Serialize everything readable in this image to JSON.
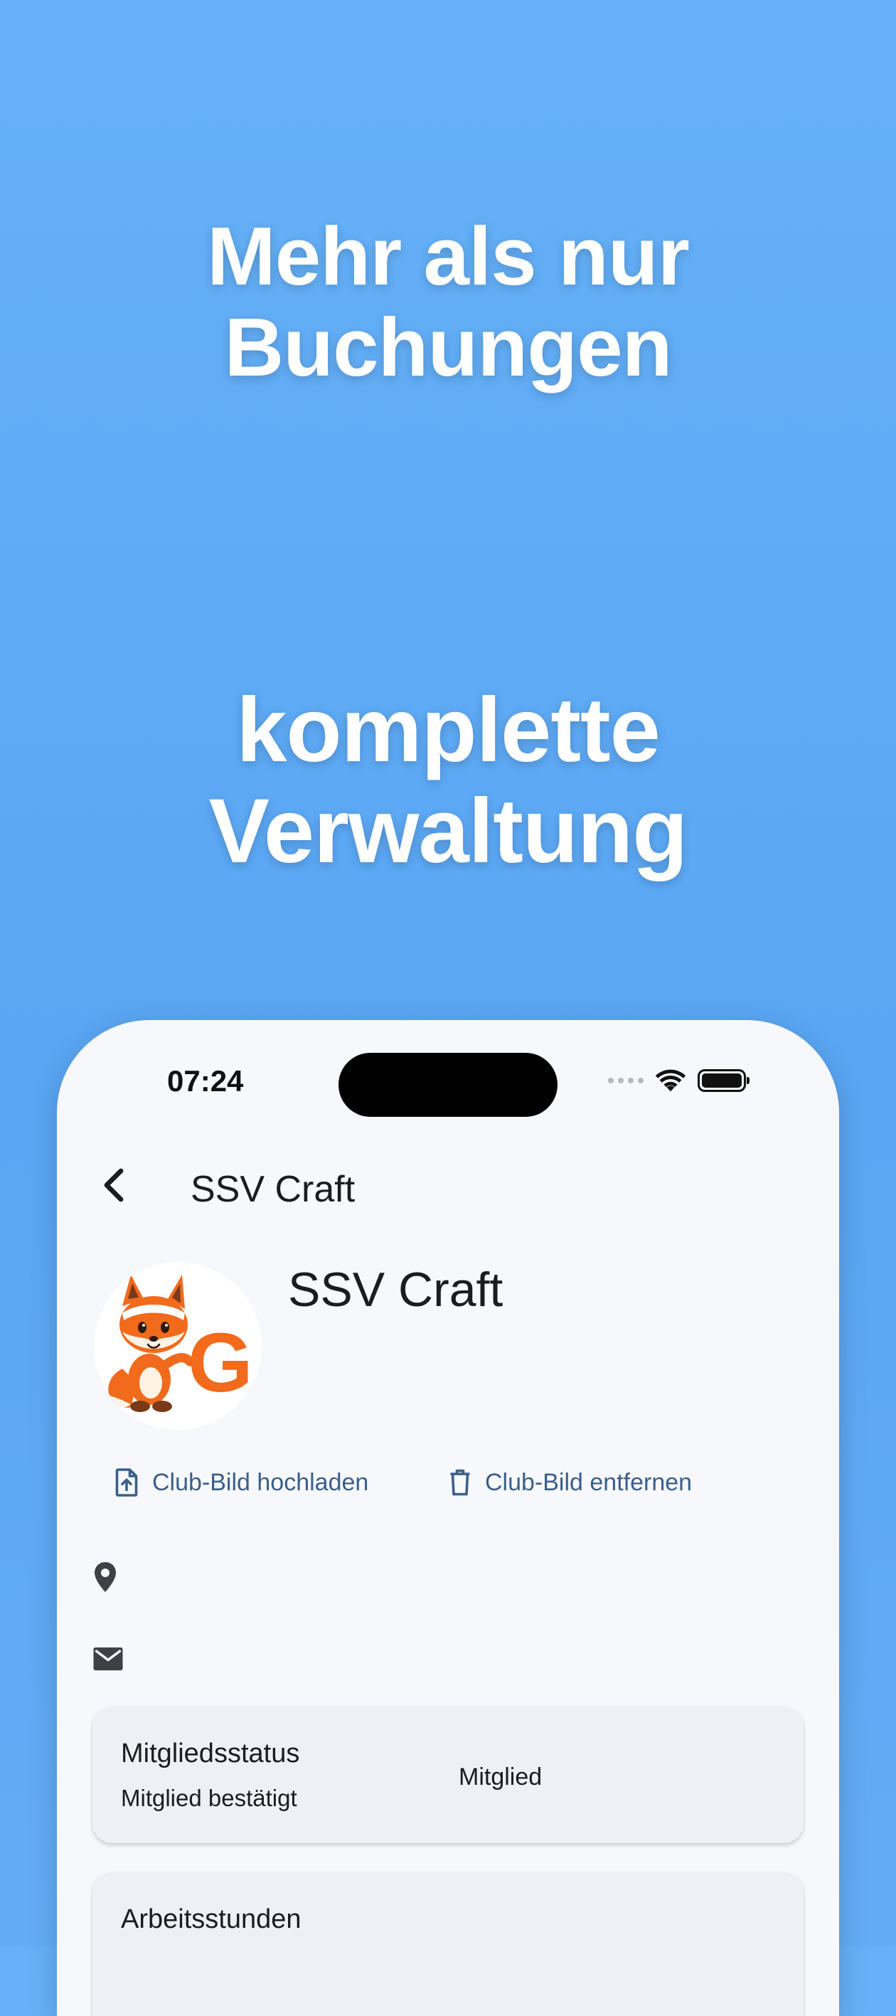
{
  "promo": {
    "headline_1": [
      "Mehr als nur",
      "Buchungen"
    ],
    "headline_2": [
      "komplette",
      "Verwaltung"
    ]
  },
  "status_bar": {
    "time": "07:24",
    "icons": [
      "signal-dots-icon",
      "wifi-icon",
      "battery-icon"
    ]
  },
  "app_bar": {
    "back_icon": "chevron-left-icon",
    "title": "SSV Craft"
  },
  "club": {
    "name": "SSV Craft",
    "avatar_icon": "fox-mascot-logo"
  },
  "actions": {
    "upload_label": "Club-Bild hochladen",
    "upload_icon": "file-upload-icon",
    "remove_label": "Club-Bild entfernen",
    "remove_icon": "trash-icon"
  },
  "info_icons": [
    "location-pin-icon",
    "mail-icon"
  ],
  "cards": {
    "membership": {
      "title": "Mitgliedsstatus",
      "subtitle": "Mitglied bestätigt",
      "value": "Mitglied"
    },
    "work_hours": {
      "title": "Arbeitsstunden"
    }
  },
  "colors": {
    "background": "#5fabf5",
    "accent": "#3a5f8a",
    "card": "#eff0f5",
    "logo_orange": "#f26a1b"
  }
}
